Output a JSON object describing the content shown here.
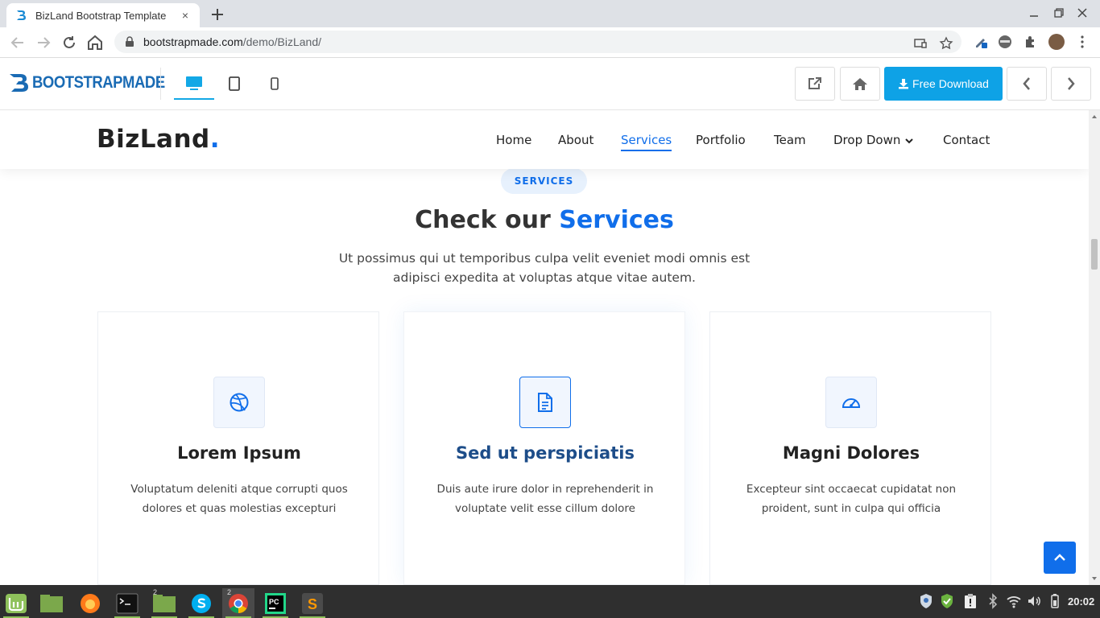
{
  "browser": {
    "tab_title": "BizLand Bootstrap Template",
    "tab_close": "×",
    "url_host": "bootstrapmade.com",
    "url_path": "/demo/BizLand/"
  },
  "preview_bar": {
    "logo_text": "BOOTSTRAPMADE",
    "download_label": "Free Download",
    "devices": [
      "desktop",
      "tablet",
      "mobile"
    ],
    "active_device": "desktop"
  },
  "site": {
    "brand": "BizLand",
    "brand_dot": ".",
    "nav": [
      "Home",
      "About",
      "Services",
      "Portfolio",
      "Team",
      "Drop Down",
      "Contact"
    ],
    "active_nav": "Services"
  },
  "services": {
    "pill": "SERVICES",
    "title_plain": "Check our ",
    "title_highlight": "Services",
    "subtitle": "Ut possimus qui ut temporibus culpa velit eveniet modi omnis est adipisci expedita at voluptas atque vitae autem.",
    "cards": [
      {
        "icon": "dribbble-icon",
        "title": "Lorem Ipsum",
        "desc": "Voluptatum deleniti atque corrupti quos dolores et quas molestias excepturi"
      },
      {
        "icon": "file-icon",
        "title": "Sed ut perspiciatis",
        "desc": "Duis aute irure dolor in reprehenderit in voluptate velit esse cillum dolore"
      },
      {
        "icon": "tachometer-icon",
        "title": "Magni Dolores",
        "desc": "Excepteur sint occaecat cupidatat non proident, sunt in culpa qui officia"
      }
    ]
  },
  "taskbar": {
    "clock": "20:02",
    "badges": {
      "files": "2",
      "chrome": "2"
    }
  },
  "colors": {
    "accent": "#106eea",
    "bootstrapmade_blue": "#0ea2e6"
  }
}
